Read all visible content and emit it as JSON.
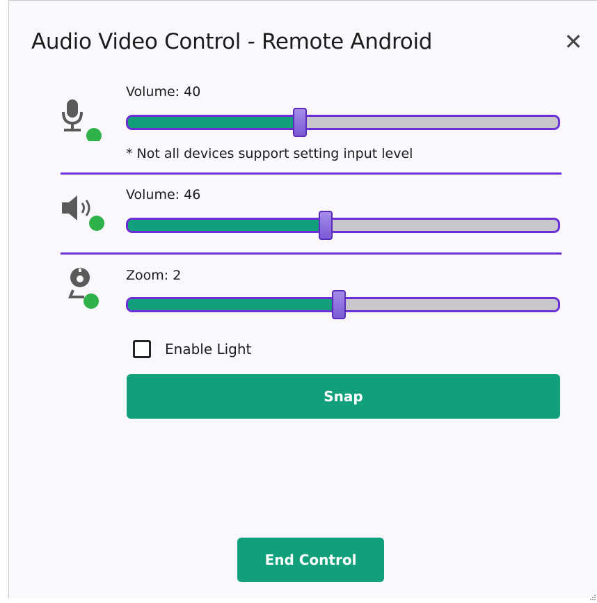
{
  "dialog": {
    "title": "Audio Video Control - Remote Android",
    "close_glyph": "✕"
  },
  "microphone": {
    "icon": "microphone-icon",
    "label": "Volume: 40",
    "value": 40,
    "max": 100,
    "note": "* Not all devices support setting input level"
  },
  "speaker": {
    "icon": "speaker-icon",
    "label": "Volume: 46",
    "value": 46,
    "max": 100
  },
  "camera": {
    "icon": "webcam-icon",
    "label": "Zoom: 2",
    "zoom_fraction": 0.49,
    "light_checkbox_label": "Enable Light",
    "light_enabled": false,
    "snap_label": "Snap"
  },
  "footer": {
    "end_control_label": "End Control"
  },
  "colors": {
    "accent_green": "#12a07c",
    "accent_purple": "#6a2fd6",
    "status_dot": "#2fb24a"
  }
}
